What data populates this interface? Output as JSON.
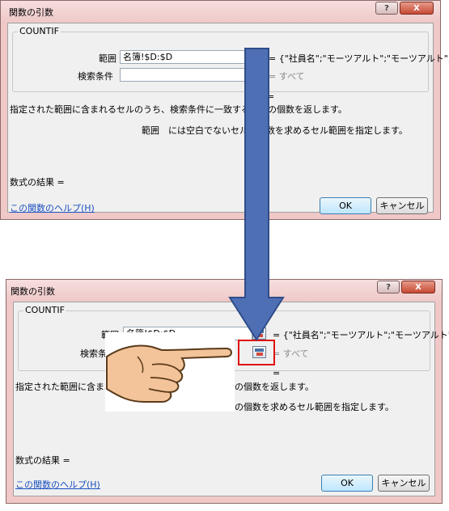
{
  "dialog": {
    "title": "関数の引数",
    "help_btn": "?",
    "close_btn": "X",
    "function_name": "COUNTIF",
    "range_label": "範囲",
    "range_value": "名簿!$D:$D",
    "range_result": "= {\"社員名\";\"モーツアルト\";\"モーツアルト\";...",
    "criteria_label": "検索条件",
    "criteria_value": "",
    "criteria_result": "= すべて",
    "eq_sign": "=",
    "description": "指定された範囲に含まれるセルのうち、検索条件に一致するセルの個数を返します。",
    "arg_name": "範囲",
    "arg_desc": "には空白でないセルの個数を求めるセル範囲を指定します。",
    "formula_result": "数式の結果 =",
    "help_link": "この関数のヘルプ(H)",
    "ok": "OK",
    "cancel": "キャンセル"
  },
  "dialog2": {
    "criteria_label_partial": "検索条",
    "description_left": "指定された範囲に含まれる",
    "description_right": "の個数を返します。",
    "arg_desc_right": "の個数を求めるセル範囲を指定します。"
  },
  "colors": {
    "arrow_fill": "#4f6fb5",
    "arrow_stroke": "#2f4d8a",
    "highlight": "#e01010",
    "dialog_frame": "#f0c8c8"
  },
  "icons": [
    "range-select-icon",
    "pointing-hand-icon",
    "down-arrow-icon"
  ]
}
